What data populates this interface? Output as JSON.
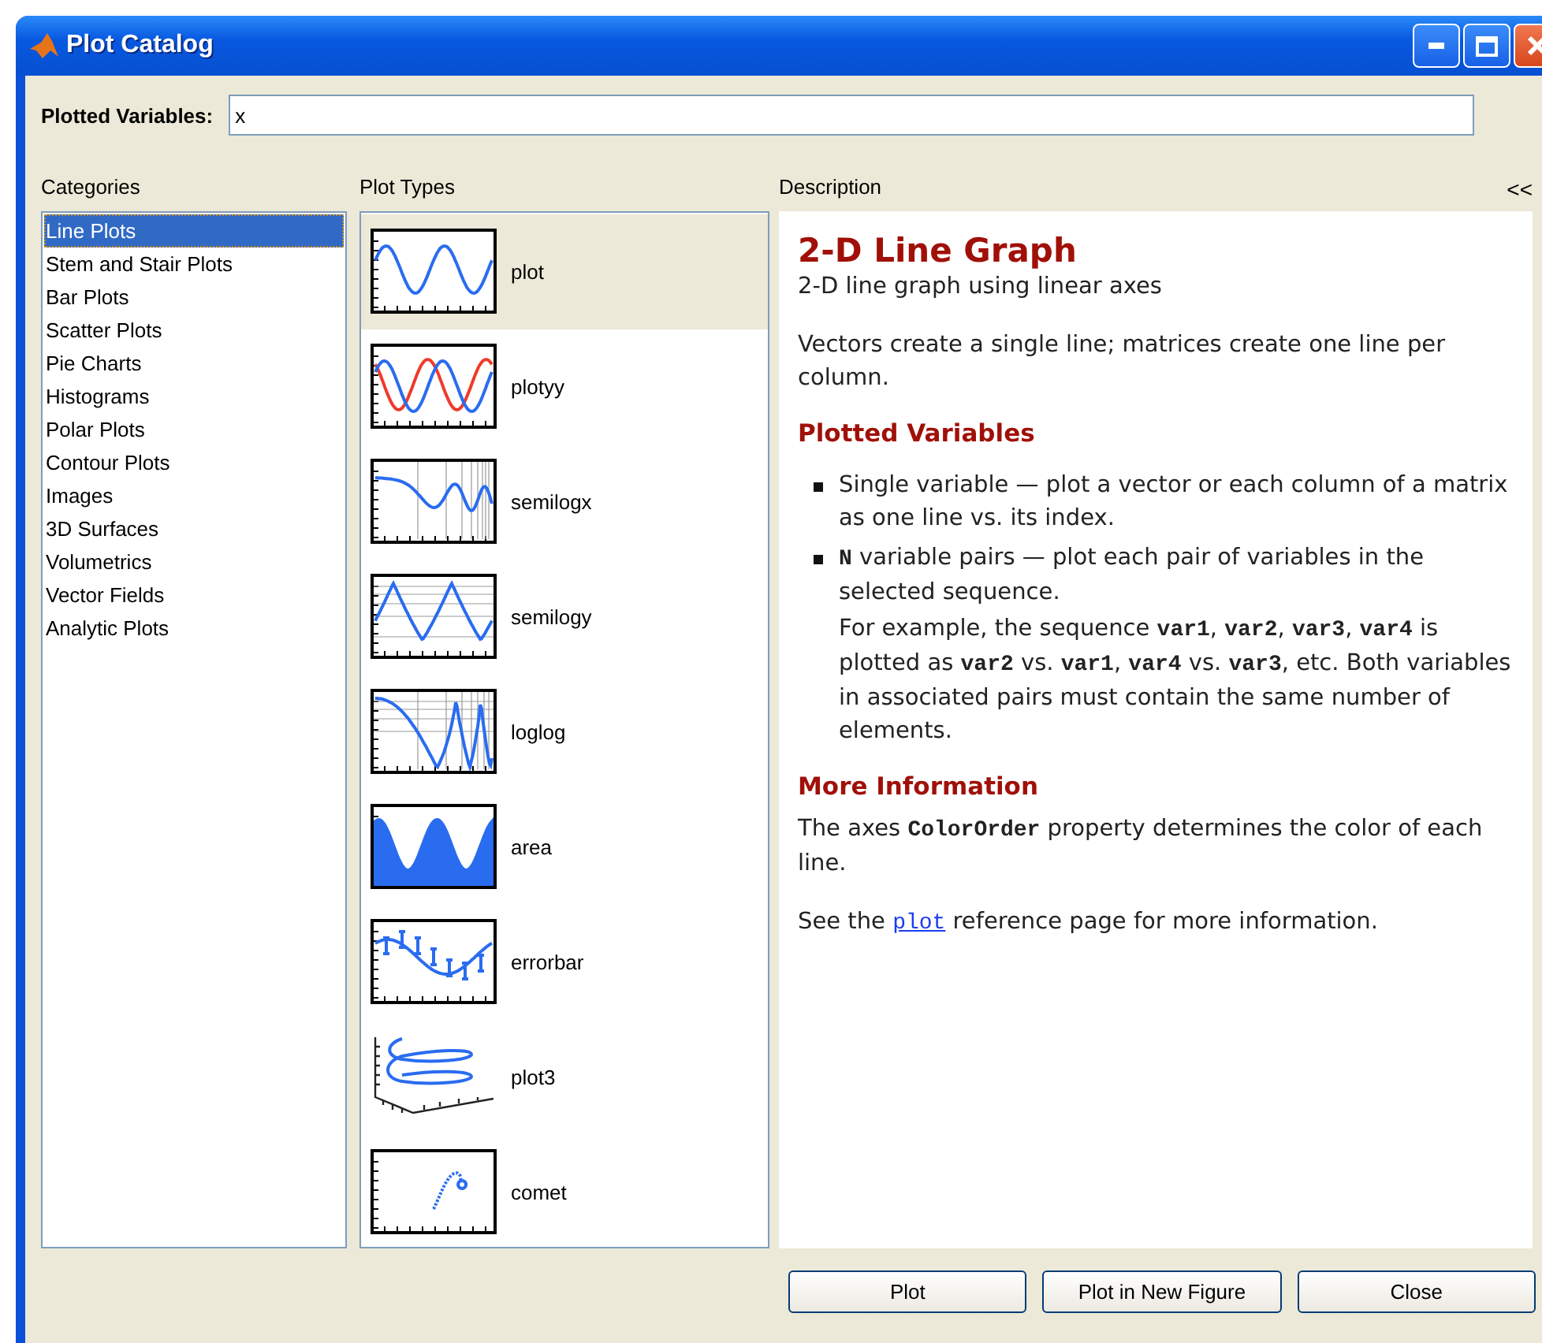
{
  "window": {
    "title": "Plot Catalog"
  },
  "plotted_variables": {
    "label": "Plotted Variables:",
    "value": "x"
  },
  "categories": {
    "heading": "Categories",
    "items": [
      {
        "label": "Line Plots",
        "selected": true
      },
      {
        "label": "Stem and Stair Plots",
        "selected": false
      },
      {
        "label": "Bar Plots",
        "selected": false
      },
      {
        "label": "Scatter Plots",
        "selected": false
      },
      {
        "label": "Pie Charts",
        "selected": false
      },
      {
        "label": "Histograms",
        "selected": false
      },
      {
        "label": "Polar Plots",
        "selected": false
      },
      {
        "label": "Contour Plots",
        "selected": false
      },
      {
        "label": "Images",
        "selected": false
      },
      {
        "label": "3D Surfaces",
        "selected": false
      },
      {
        "label": "Volumetrics",
        "selected": false
      },
      {
        "label": "Vector Fields",
        "selected": false
      },
      {
        "label": "Analytic Plots",
        "selected": false
      }
    ]
  },
  "plot_types": {
    "heading": "Plot Types",
    "items": [
      {
        "label": "plot",
        "kind": "line",
        "selected": true
      },
      {
        "label": "plotyy",
        "kind": "twoaxes",
        "selected": false
      },
      {
        "label": "semilogx",
        "kind": "logx",
        "selected": false
      },
      {
        "label": "semilogy",
        "kind": "logy",
        "selected": false
      },
      {
        "label": "loglog",
        "kind": "loglog",
        "selected": false
      },
      {
        "label": "area",
        "kind": "area",
        "selected": false
      },
      {
        "label": "errorbar",
        "kind": "errorbar",
        "selected": false
      },
      {
        "label": "plot3",
        "kind": "spiral3d",
        "selected": false
      },
      {
        "label": "comet",
        "kind": "comet",
        "selected": false
      }
    ]
  },
  "description": {
    "heading": "Description",
    "collapse": "<<",
    "title": "2-D Line Graph",
    "subtitle": "2-D line graph using linear axes",
    "intro": [
      {
        "kind": "text",
        "text": "Vectors create a single line; matrices create one line per column."
      }
    ],
    "sections": [
      {
        "heading": "Plotted Variables",
        "bullets": [
          {
            "segments": [
              {
                "kind": "text",
                "text": "Single variable — plot a vector or each column of a matrix as one line vs. its index."
              }
            ]
          },
          {
            "segments": [
              {
                "kind": "code",
                "text": "N"
              },
              {
                "kind": "text",
                "text": " variable pairs — plot each pair of variables in the selected sequence."
              }
            ],
            "note": [
              {
                "kind": "text",
                "text": "For example, the sequence "
              },
              {
                "kind": "code",
                "text": "var1"
              },
              {
                "kind": "text",
                "text": ", "
              },
              {
                "kind": "code",
                "text": "var2"
              },
              {
                "kind": "text",
                "text": ", "
              },
              {
                "kind": "code",
                "text": "var3"
              },
              {
                "kind": "text",
                "text": ", "
              },
              {
                "kind": "code",
                "text": "var4"
              },
              {
                "kind": "text",
                "text": " is plotted as "
              },
              {
                "kind": "code",
                "text": "var2"
              },
              {
                "kind": "text",
                "text": " vs. "
              },
              {
                "kind": "code",
                "text": "var1"
              },
              {
                "kind": "text",
                "text": ", "
              },
              {
                "kind": "code",
                "text": "var4"
              },
              {
                "kind": "text",
                "text": " vs. "
              },
              {
                "kind": "code",
                "text": "var3"
              },
              {
                "kind": "text",
                "text": ", etc. Both variables in associated pairs must contain the same number of elements."
              }
            ]
          }
        ]
      },
      {
        "heading": "More Information",
        "paragraphs": [
          [
            {
              "kind": "text",
              "text": "The axes "
            },
            {
              "kind": "code",
              "text": "ColorOrder"
            },
            {
              "kind": "text",
              "text": " property determines the color of each line."
            }
          ],
          [
            {
              "kind": "text",
              "text": "See the "
            },
            {
              "kind": "link",
              "text": "plot"
            },
            {
              "kind": "text",
              "text": " reference page for more information."
            }
          ]
        ]
      }
    ]
  },
  "buttons": [
    "Plot",
    "Plot in New Figure",
    "Close"
  ]
}
